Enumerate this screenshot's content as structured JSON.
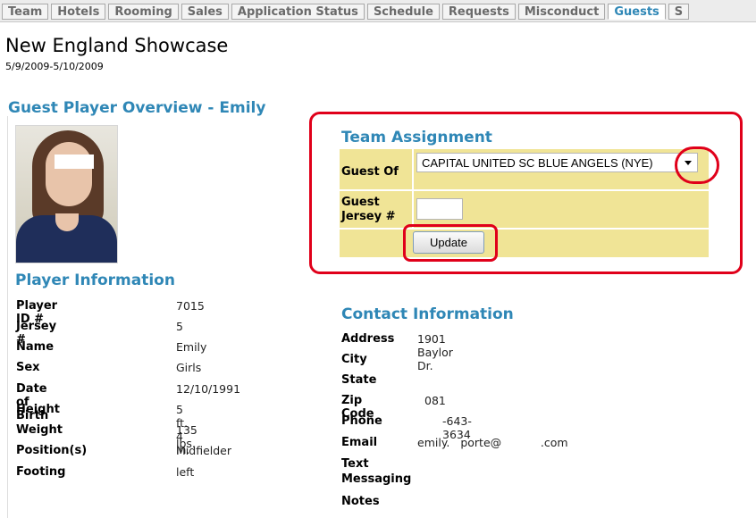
{
  "tabs": [
    {
      "label": "Team",
      "active": false
    },
    {
      "label": "Hotels",
      "active": false
    },
    {
      "label": "Rooming",
      "active": false
    },
    {
      "label": "Sales",
      "active": false
    },
    {
      "label": "Application Status",
      "active": false
    },
    {
      "label": "Schedule",
      "active": false
    },
    {
      "label": "Requests",
      "active": false
    },
    {
      "label": "Misconduct",
      "active": false
    },
    {
      "label": "Guests",
      "active": true
    },
    {
      "label": "S",
      "active": false
    }
  ],
  "header": {
    "title": "New England Showcase",
    "dates": "5/9/2009-5/10/2009"
  },
  "overview": {
    "title": "Guest Player Overview - Emily"
  },
  "player_info": {
    "title": "Player Information",
    "rows": [
      {
        "label": "Player ID #",
        "value": "7015"
      },
      {
        "label": "Jersey #",
        "value": "5"
      },
      {
        "label": "Name",
        "value": "Emily"
      },
      {
        "label": "Sex",
        "value": "Girls"
      },
      {
        "label": "Date of Birth",
        "value": "12/10/1991"
      },
      {
        "label": "Height",
        "value": "5 ft.  4 in."
      },
      {
        "label": "Weight",
        "value": "135 lbs."
      },
      {
        "label": "Position(s)",
        "value": "Midfielder"
      },
      {
        "label": "Footing",
        "value": "left"
      }
    ]
  },
  "team_assignment": {
    "title": "Team Assignment",
    "guest_of_label": "Guest Of",
    "guest_of_value": "CAPITAL UNITED SC BLUE ANGELS (NYE)",
    "jersey_label": "Guest Jersey #",
    "jersey_value": "",
    "update_label": "Update"
  },
  "contact": {
    "title": "Contact Information",
    "rows": [
      {
        "label": "Address",
        "value": "1901 Baylor Dr."
      },
      {
        "label": "City",
        "value": ""
      },
      {
        "label": "State",
        "value": ""
      },
      {
        "label": "Zip Code",
        "value": "081"
      },
      {
        "label": "Phone",
        "value": "-643-3634"
      },
      {
        "label": "Email",
        "value": "emily.   porte@           .com"
      },
      {
        "label": "Text Messaging",
        "value": ""
      },
      {
        "label": "Notes",
        "value": ""
      }
    ]
  },
  "colors": {
    "accent": "#2f87b6",
    "highlight": "#f0e496",
    "annotation": "#e0001a"
  }
}
